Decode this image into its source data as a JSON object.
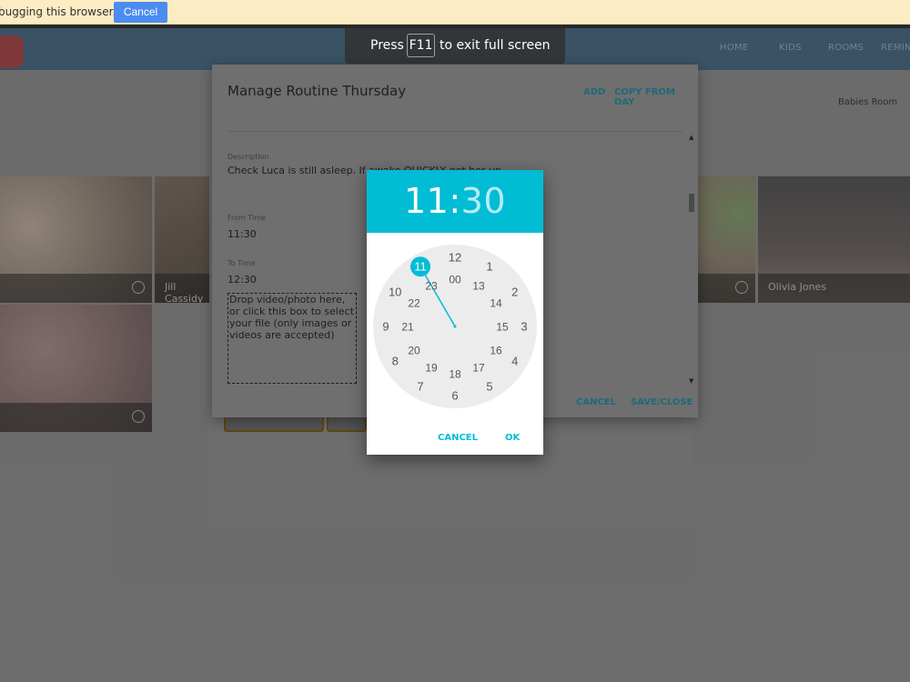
{
  "infobar": {
    "text": "bugging this browser.",
    "cancel_label": "Cancel"
  },
  "nav": {
    "items": [
      "HOME",
      "KIDS",
      "ROOMS",
      "REMIN"
    ]
  },
  "room_label": "Babies Room",
  "cards": [
    {
      "name": ""
    },
    {
      "name": "Jill Cassidy"
    },
    {
      "name": ""
    },
    {
      "name": "Olivia Jones"
    },
    {
      "name": ""
    }
  ],
  "fullscreen": {
    "press": "Press",
    "key": "F11",
    "rest": "to exit full screen"
  },
  "dialog": {
    "title": "Manage Routine Thursday",
    "add_label": "ADD",
    "copy_label": "COPY FROM DAY",
    "description_label": "Description",
    "description_value": "Check Luca is still asleep. If awake QUICKLY get her up",
    "from_label": "From Time",
    "from_value": "11:30",
    "to_label": "To Time",
    "to_value": "12:30",
    "dropzone_text": "Drop video/photo here, or click this box to select your file (only images or videos are accepted)",
    "cancel_label": "CANCEL",
    "save_label": "SAVE/CLOSE"
  },
  "picker": {
    "hours": "11",
    "separator": ":",
    "minutes": "30",
    "selected_hour": "11",
    "outer_ring": [
      "12",
      "1",
      "2",
      "3",
      "4",
      "5",
      "6",
      "7",
      "8",
      "9",
      "10",
      "11"
    ],
    "inner_ring": [
      "00",
      "13",
      "14",
      "15",
      "16",
      "17",
      "18",
      "19",
      "20",
      "21",
      "22",
      "23"
    ],
    "cancel_label": "CANCEL",
    "ok_label": "OK"
  },
  "colors": {
    "accent": "#00bcd4",
    "dialog_link": "#1b6b78",
    "infobar_bg": "#fcecc4",
    "infobar_button": "#4c8cf0"
  }
}
